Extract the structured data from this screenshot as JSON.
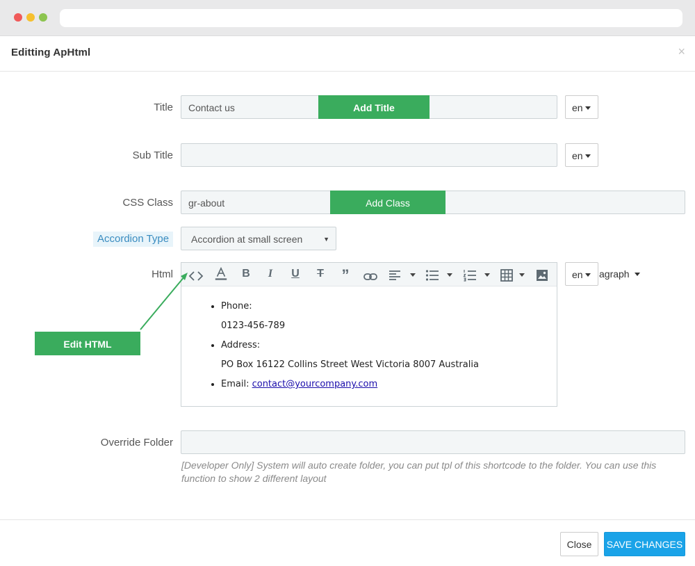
{
  "modal": {
    "title": "Editting ApHtml",
    "close_icon": "×"
  },
  "form": {
    "title_label": "Title",
    "title_value": "Contact us",
    "title_lang": "en",
    "subtitle_label": "Sub Title",
    "subtitle_value": "",
    "subtitle_lang": "en",
    "css_class_label": "CSS Class",
    "css_class_value": "gr-about",
    "accordion_label": "Accordion Type",
    "accordion_value": "Accordion at small screen",
    "html_label": "Html",
    "html_lang": "en",
    "paragraph_label": "agraph",
    "override_label": "Override Folder",
    "override_value": "",
    "help_text": "[Developer Only] System will auto create folder, you can put tpl of this shortcode to the folder. You can use this function to show 2 different layout"
  },
  "callouts": {
    "add_title": "Add Title",
    "add_class": "Add Class",
    "edit_html": "Edit HTML"
  },
  "editor": {
    "toolbar_icons": [
      "code-view-icon",
      "font-color-icon",
      "bold-icon",
      "italic-icon",
      "underline-icon",
      "strikethrough-icon",
      "blockquote-icon",
      "link-icon",
      "align-icon",
      "bullet-list-icon",
      "numbered-list-icon",
      "table-icon",
      "image-icon"
    ],
    "content": {
      "phone_label": "Phone:",
      "phone_value": "0123-456-789",
      "address_label": "Address:",
      "address_value": "PO Box 16122 Collins Street West Victoria 8007 Australia",
      "email_label": "Email:",
      "email_value": "contact@yourcompany.com"
    }
  },
  "footer": {
    "close_label": "Close",
    "save_label": "SAVE CHANGES"
  },
  "colors": {
    "accent_green": "#3aac5d",
    "save_blue": "#1aa3e8",
    "link": "#1a0dab"
  }
}
